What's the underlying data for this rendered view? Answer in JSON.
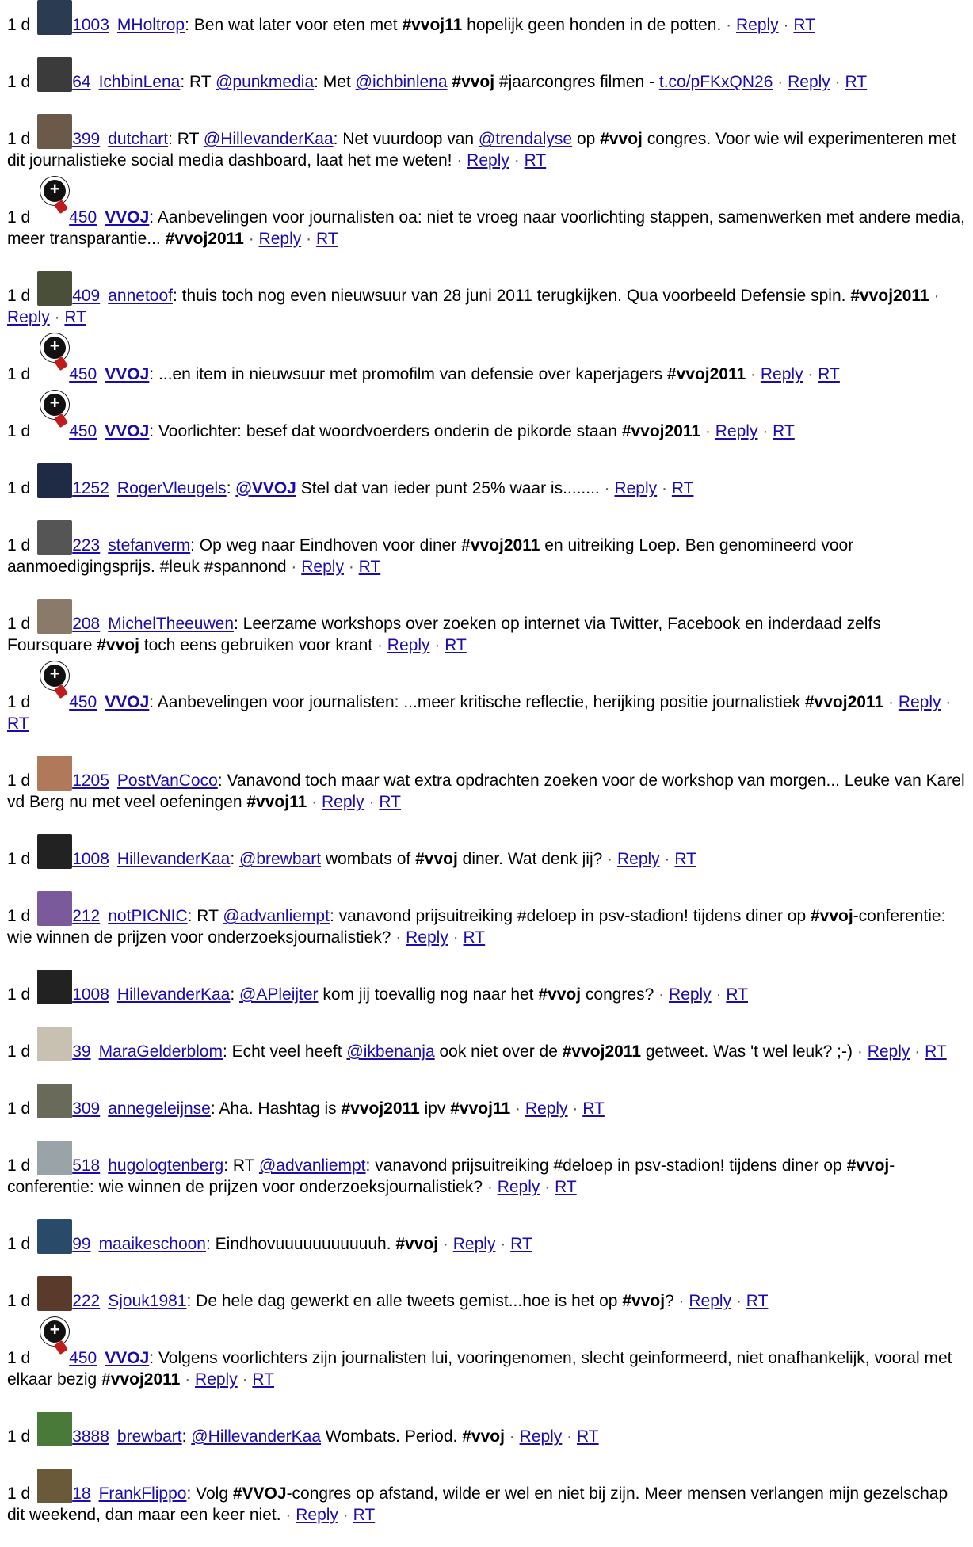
{
  "tweets": [
    {
      "age": "1 d",
      "avatar": "avatar-photo",
      "avatar_color": "#2a3b52",
      "count": "1003",
      "user": "MHoltrop",
      "user_bold": false,
      "parts": [
        {
          "t": "text",
          "v": ": Ben wat later voor eten met "
        },
        {
          "t": "tag",
          "v": "#vvoj11"
        },
        {
          "t": "text",
          "v": " hopelijk geen honden in de potten. "
        }
      ],
      "reply": "Reply",
      "rt": "RT"
    },
    {
      "age": "1 d",
      "avatar": "avatar-photo",
      "avatar_color": "#3b3b3b",
      "count": "64",
      "user": "IchbinLena",
      "user_bold": false,
      "parts": [
        {
          "t": "text",
          "v": ": RT "
        },
        {
          "t": "link",
          "v": "@punkmedia"
        },
        {
          "t": "text",
          "v": ": Met "
        },
        {
          "t": "link",
          "v": "@ichbinlena"
        },
        {
          "t": "text",
          "v": " "
        },
        {
          "t": "tag",
          "v": "#vvoj"
        },
        {
          "t": "text",
          "v": " #jaarcongres filmen - "
        },
        {
          "t": "link",
          "v": "t.co/pFKxQN26"
        },
        {
          "t": "text",
          "v": " "
        }
      ],
      "reply": "Reply",
      "rt": "RT"
    },
    {
      "age": "1 d",
      "avatar": "avatar-photo",
      "avatar_color": "#6b5a4a",
      "count": "399",
      "user": "dutchart",
      "user_bold": false,
      "parts": [
        {
          "t": "text",
          "v": ": RT "
        },
        {
          "t": "link",
          "v": "@HillevanderKaa"
        },
        {
          "t": "text",
          "v": ": Net vuurdoop van "
        },
        {
          "t": "link",
          "v": "@trendalyse"
        },
        {
          "t": "text",
          "v": " op "
        },
        {
          "t": "tag",
          "v": "#vvoj"
        },
        {
          "t": "text",
          "v": " congres. Voor wie wil experimenteren met dit journalistieke social media dashboard, laat het me weten! "
        }
      ],
      "reply": "Reply",
      "rt": "RT"
    },
    {
      "age": "1 d",
      "avatar": "magnify-icon",
      "avatar_color": "#111111",
      "count": "450",
      "user": "VVOJ",
      "user_bold": true,
      "parts": [
        {
          "t": "text",
          "v": ": Aanbevelingen voor journalisten oa: niet te vroeg naar voorlichting stappen, samenwerken met andere media, meer transparantie... "
        },
        {
          "t": "tag",
          "v": "#vvoj2011"
        },
        {
          "t": "text",
          "v": " "
        }
      ],
      "reply": "Reply",
      "rt": "RT"
    },
    {
      "age": "1 d",
      "avatar": "avatar-photo",
      "avatar_color": "#4a4f3a",
      "count": "409",
      "user": "annetoof",
      "user_bold": false,
      "parts": [
        {
          "t": "text",
          "v": ": thuis toch nog even nieuwsuur van 28 juni 2011 terugkijken. Qua voorbeeld Defensie spin. "
        },
        {
          "t": "tag",
          "v": "#vvoj2011"
        },
        {
          "t": "text",
          "v": " "
        }
      ],
      "reply": "Reply",
      "rt": "RT"
    },
    {
      "age": "1 d",
      "avatar": "magnify-icon",
      "avatar_color": "#111111",
      "count": "450",
      "user": "VVOJ",
      "user_bold": true,
      "parts": [
        {
          "t": "text",
          "v": ": ...en item in nieuwsuur met promofilm van defensie over kaperjagers "
        },
        {
          "t": "tag",
          "v": "#vvoj2011"
        },
        {
          "t": "text",
          "v": " "
        }
      ],
      "reply": "Reply",
      "rt": "RT"
    },
    {
      "age": "1 d",
      "avatar": "magnify-icon",
      "avatar_color": "#111111",
      "count": "450",
      "user": "VVOJ",
      "user_bold": true,
      "parts": [
        {
          "t": "text",
          "v": ": Voorlichter: besef dat woordvoerders onderin de pikorde staan "
        },
        {
          "t": "tag",
          "v": "#vvoj2011"
        },
        {
          "t": "text",
          "v": " "
        }
      ],
      "reply": "Reply",
      "rt": "RT"
    },
    {
      "age": "1 d",
      "avatar": "avatar-photo",
      "avatar_color": "#1f2a44",
      "count": "1252",
      "user": "RogerVleugels",
      "user_bold": false,
      "parts": [
        {
          "t": "text",
          "v": ": "
        },
        {
          "t": "boldlink",
          "v": "@VVOJ"
        },
        {
          "t": "text",
          "v": " Stel dat van ieder punt 25% waar is........ "
        }
      ],
      "reply": "Reply",
      "rt": "RT"
    },
    {
      "age": "1 d",
      "avatar": "avatar-photo",
      "avatar_color": "#555555",
      "count": "223",
      "user": "stefanverm",
      "user_bold": false,
      "parts": [
        {
          "t": "text",
          "v": ": Op weg naar Eindhoven voor diner "
        },
        {
          "t": "tag",
          "v": "#vvoj2011"
        },
        {
          "t": "text",
          "v": " en uitreiking Loep. Ben genomineerd voor aanmoedigingsprijs. #leuk #spannond "
        }
      ],
      "reply": "Reply",
      "rt": "RT"
    },
    {
      "age": "1 d",
      "avatar": "avatar-photo",
      "avatar_color": "#8a7a6a",
      "count": "208",
      "user": "MichelTheeuwen",
      "user_bold": false,
      "parts": [
        {
          "t": "text",
          "v": ": Leerzame workshops over zoeken op internet via Twitter, Facebook en inderdaad zelfs Foursquare "
        },
        {
          "t": "tag",
          "v": "#vvoj"
        },
        {
          "t": "text",
          "v": " toch eens gebruiken voor krant "
        }
      ],
      "reply": "Reply",
      "rt": "RT"
    },
    {
      "age": "1 d",
      "avatar": "magnify-icon",
      "avatar_color": "#111111",
      "count": "450",
      "user": "VVOJ",
      "user_bold": true,
      "parts": [
        {
          "t": "text",
          "v": ": Aanbevelingen voor journalisten: ...meer kritische reflectie, herijking positie journalistiek "
        },
        {
          "t": "tag",
          "v": "#vvoj2011"
        },
        {
          "t": "text",
          "v": " "
        }
      ],
      "reply": "Reply",
      "rt": "RT"
    },
    {
      "age": "1 d",
      "avatar": "avatar-photo",
      "avatar_color": "#b07a5a",
      "count": "1205",
      "user": "PostVanCoco",
      "user_bold": false,
      "parts": [
        {
          "t": "text",
          "v": ": Vanavond toch maar wat extra opdrachten zoeken voor de workshop van morgen... Leuke van Karel vd Berg nu met veel oefeningen "
        },
        {
          "t": "tag",
          "v": "#vvoj11"
        },
        {
          "t": "text",
          "v": " "
        }
      ],
      "reply": "Reply",
      "rt": "RT"
    },
    {
      "age": "1 d",
      "avatar": "avatar-photo",
      "avatar_color": "#222222",
      "count": "1008",
      "user": "HillevanderKaa",
      "user_bold": false,
      "parts": [
        {
          "t": "text",
          "v": ": "
        },
        {
          "t": "link",
          "v": "@brewbart"
        },
        {
          "t": "text",
          "v": " wombats of "
        },
        {
          "t": "tag",
          "v": "#vvoj"
        },
        {
          "t": "text",
          "v": " diner. Wat denk jij? "
        }
      ],
      "reply": "Reply",
      "rt": "RT"
    },
    {
      "age": "1 d",
      "avatar": "avatar-photo",
      "avatar_color": "#7a5a9a",
      "count": "212",
      "user": "notPICNIC",
      "user_bold": false,
      "parts": [
        {
          "t": "text",
          "v": ": RT "
        },
        {
          "t": "link",
          "v": "@advanliempt"
        },
        {
          "t": "text",
          "v": ": vanavond prijsuitreiking #deloep in psv-stadion! tijdens diner op "
        },
        {
          "t": "tag",
          "v": "#vvoj"
        },
        {
          "t": "text",
          "v": "-conferentie: wie winnen de prijzen voor onderzoeksjournalistiek? "
        }
      ],
      "reply": "Reply",
      "rt": "RT"
    },
    {
      "age": "1 d",
      "avatar": "avatar-photo",
      "avatar_color": "#222222",
      "count": "1008",
      "user": "HillevanderKaa",
      "user_bold": false,
      "parts": [
        {
          "t": "text",
          "v": ": "
        },
        {
          "t": "link",
          "v": "@APleijter"
        },
        {
          "t": "text",
          "v": " kom jij toevallig nog naar het "
        },
        {
          "t": "tag",
          "v": "#vvoj"
        },
        {
          "t": "text",
          "v": " congres? "
        }
      ],
      "reply": "Reply",
      "rt": "RT"
    },
    {
      "age": "1 d",
      "avatar": "avatar-photo",
      "avatar_color": "#c8c0b0",
      "count": "39",
      "user": "MaraGelderblom",
      "user_bold": false,
      "parts": [
        {
          "t": "text",
          "v": ": Echt veel heeft "
        },
        {
          "t": "link",
          "v": "@ikbenanja"
        },
        {
          "t": "text",
          "v": " ook niet over de "
        },
        {
          "t": "tag",
          "v": "#vvoj2011"
        },
        {
          "t": "text",
          "v": " getweet. Was 't wel leuk? ;-) "
        }
      ],
      "reply": "Reply",
      "rt": "RT"
    },
    {
      "age": "1 d",
      "avatar": "avatar-photo",
      "avatar_color": "#6a6a5a",
      "count": "309",
      "user": "annegeleijnse",
      "user_bold": false,
      "parts": [
        {
          "t": "text",
          "v": ": Aha. Hashtag is "
        },
        {
          "t": "tag",
          "v": "#vvoj2011"
        },
        {
          "t": "text",
          "v": " ipv "
        },
        {
          "t": "tag",
          "v": "#vvoj11"
        },
        {
          "t": "text",
          "v": " "
        }
      ],
      "reply": "Reply",
      "rt": "RT"
    },
    {
      "age": "1 d",
      "avatar": "avatar-photo",
      "avatar_color": "#9aa4a8",
      "count": "518",
      "user": "hugologtenberg",
      "user_bold": false,
      "parts": [
        {
          "t": "text",
          "v": ": RT "
        },
        {
          "t": "link",
          "v": "@advanliempt"
        },
        {
          "t": "text",
          "v": ": vanavond prijsuitreiking #deloep in psv-stadion! tijdens diner op "
        },
        {
          "t": "tag",
          "v": "#vvoj"
        },
        {
          "t": "text",
          "v": "-conferentie: wie winnen de prijzen voor onderzoeksjournalistiek? "
        }
      ],
      "reply": "Reply",
      "rt": "RT"
    },
    {
      "age": "1 d",
      "avatar": "avatar-photo",
      "avatar_color": "#2a4a6a",
      "count": "99",
      "user": "maaikeschoon",
      "user_bold": false,
      "parts": [
        {
          "t": "text",
          "v": ": Eindhovuuuuuuuuuuuh. "
        },
        {
          "t": "tag",
          "v": "#vvoj"
        },
        {
          "t": "text",
          "v": " "
        }
      ],
      "reply": "Reply",
      "rt": "RT"
    },
    {
      "age": "1 d",
      "avatar": "avatar-photo",
      "avatar_color": "#5a3a2a",
      "count": "222",
      "user": "Sjouk1981",
      "user_bold": false,
      "parts": [
        {
          "t": "text",
          "v": ": De hele dag gewerkt en alle tweets gemist...hoe is het op "
        },
        {
          "t": "tag",
          "v": "#vvoj"
        },
        {
          "t": "text",
          "v": "? "
        }
      ],
      "reply": "Reply",
      "rt": "RT"
    },
    {
      "age": "1 d",
      "avatar": "magnify-icon",
      "avatar_color": "#111111",
      "count": "450",
      "user": "VVOJ",
      "user_bold": true,
      "parts": [
        {
          "t": "text",
          "v": ": Volgens voorlichters zijn journalisten lui, vooringenomen, slecht geinformeerd, niet onafhankelijk, vooral met elkaar bezig "
        },
        {
          "t": "tag",
          "v": "#vvoj2011"
        },
        {
          "t": "text",
          "v": " "
        }
      ],
      "reply": "Reply",
      "rt": "RT"
    },
    {
      "age": "1 d",
      "avatar": "avatar-photo",
      "avatar_color": "#4a7a3a",
      "count": "3888",
      "user": "brewbart",
      "user_bold": false,
      "parts": [
        {
          "t": "text",
          "v": ": "
        },
        {
          "t": "link",
          "v": "@HillevanderKaa"
        },
        {
          "t": "text",
          "v": " Wombats. Period. "
        },
        {
          "t": "tag",
          "v": "#vvoj"
        },
        {
          "t": "text",
          "v": " "
        }
      ],
      "reply": "Reply",
      "rt": "RT"
    },
    {
      "age": "1 d",
      "avatar": "avatar-photo",
      "avatar_color": "#6a5a3a",
      "count": "18",
      "user": "FrankFlippo",
      "user_bold": false,
      "parts": [
        {
          "t": "text",
          "v": ": Volg "
        },
        {
          "t": "tag",
          "v": "#VVOJ"
        },
        {
          "t": "text",
          "v": "-congres op afstand, wilde er wel en niet bij zijn. Meer mensen verlangen mijn gezelschap dit weekend, dan maar een keer niet. "
        }
      ],
      "reply": "Reply",
      "rt": "RT"
    }
  ],
  "separator": "·"
}
